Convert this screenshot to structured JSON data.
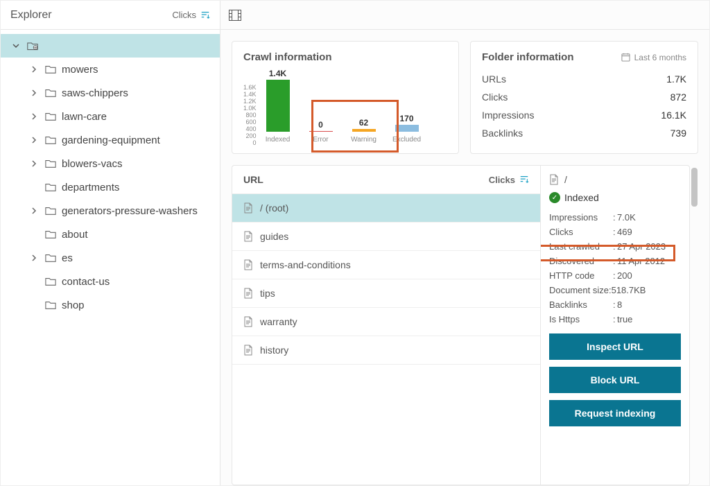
{
  "sidebar": {
    "title": "Explorer",
    "sort_label": "Clicks",
    "items": [
      {
        "label": "mowers",
        "expandable": true
      },
      {
        "label": "saws-chippers",
        "expandable": true
      },
      {
        "label": "lawn-care",
        "expandable": true
      },
      {
        "label": "gardening-equipment",
        "expandable": true
      },
      {
        "label": "blowers-vacs",
        "expandable": true
      },
      {
        "label": "departments",
        "expandable": false
      },
      {
        "label": "generators-pressure-washers",
        "expandable": true
      },
      {
        "label": "about",
        "expandable": false
      },
      {
        "label": "es",
        "expandable": true
      },
      {
        "label": "contact-us",
        "expandable": false
      },
      {
        "label": "shop",
        "expandable": false
      }
    ]
  },
  "crawl": {
    "title": "Crawl information",
    "indexed": {
      "label": "Indexed",
      "value": "1.4K"
    },
    "error": {
      "label": "Error",
      "value": "0"
    },
    "warning": {
      "label": "Warning",
      "value": "62"
    },
    "excluded": {
      "label": "Excluded",
      "value": "170"
    },
    "yticks": [
      "1.6K",
      "1.4K",
      "1.2K",
      "1.0K",
      "800",
      "600",
      "400",
      "200",
      "0"
    ]
  },
  "folder": {
    "title": "Folder information",
    "range": "Last 6 months",
    "rows": [
      {
        "k": "URLs",
        "v": "1.7K"
      },
      {
        "k": "Clicks",
        "v": "872"
      },
      {
        "k": "Impressions",
        "v": "16.1K"
      },
      {
        "k": "Backlinks",
        "v": "739"
      }
    ]
  },
  "urls": {
    "header": "URL",
    "sort_label": "Clicks",
    "items": [
      {
        "label": "/ (root)",
        "selected": true
      },
      {
        "label": "guides"
      },
      {
        "label": "terms-and-conditions"
      },
      {
        "label": "tips"
      },
      {
        "label": "warranty"
      },
      {
        "label": "history"
      }
    ]
  },
  "detail": {
    "url": "/",
    "status": "Indexed",
    "rows": [
      {
        "k": "Impressions",
        "v": "7.0K"
      },
      {
        "k": "Clicks",
        "v": "469"
      },
      {
        "k": "Last crawled",
        "v": "27 Apr 2023"
      },
      {
        "k": "Discovered",
        "v": "11 Apr 2012"
      },
      {
        "k": "HTTP code",
        "v": "200"
      },
      {
        "k": "Document size",
        "v": "518.7KB",
        "nocolon": true
      },
      {
        "k": "Backlinks",
        "v": "8"
      },
      {
        "k": "Is Https",
        "v": "true"
      }
    ],
    "buttons": {
      "inspect": "Inspect URL",
      "block": "Block URL",
      "request": "Request indexing"
    }
  },
  "chart_data": {
    "type": "bar",
    "title": "Crawl information",
    "categories": [
      "Indexed",
      "Error",
      "Warning",
      "Excluded"
    ],
    "values": [
      1400,
      0,
      62,
      170
    ],
    "ylim": [
      0,
      1600
    ],
    "yticks": [
      0,
      200,
      400,
      600,
      800,
      1000,
      1200,
      1400,
      1600
    ],
    "colors": [
      "#2a9d2a",
      "#d84b4b",
      "#f5a623",
      "#8cbde0"
    ]
  }
}
